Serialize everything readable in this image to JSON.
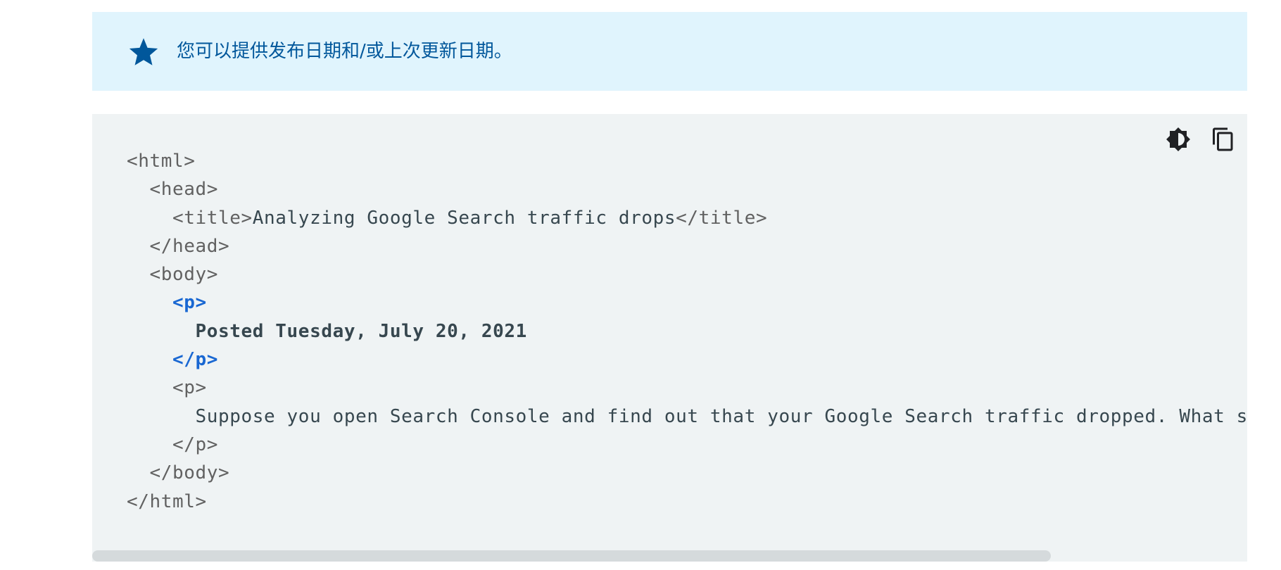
{
  "note": {
    "icon": "star-icon",
    "text": "您可以提供发布日期和/或上次更新日期。",
    "text_color": "#01579b",
    "background": "#e0f4fd"
  },
  "toolbar": {
    "theme_icon": "brightness-contrast-icon",
    "copy_icon": "copy-icon"
  },
  "code": {
    "background": "#eff3f4",
    "lines": [
      {
        "indent": "",
        "parts": [
          {
            "t": "<html>",
            "c": "tag"
          }
        ]
      },
      {
        "indent": "  ",
        "parts": [
          {
            "t": "<head>",
            "c": "tag"
          }
        ]
      },
      {
        "indent": "    ",
        "parts": [
          {
            "t": "<title>",
            "c": "tag"
          },
          {
            "t": "Analyzing Google Search traffic drops",
            "c": "txt"
          },
          {
            "t": "</title>",
            "c": "tag"
          }
        ]
      },
      {
        "indent": "  ",
        "parts": [
          {
            "t": "</head>",
            "c": "tag"
          }
        ]
      },
      {
        "indent": "  ",
        "parts": [
          {
            "t": "<body>",
            "c": "tag"
          }
        ]
      },
      {
        "indent": "    ",
        "parts": [
          {
            "t": "<p>",
            "c": "hl-tag"
          }
        ]
      },
      {
        "indent": "      ",
        "parts": [
          {
            "t": "Posted Tuesday, July 20, 2021",
            "c": "hl-text"
          }
        ]
      },
      {
        "indent": "    ",
        "parts": [
          {
            "t": "</p>",
            "c": "hl-tag"
          }
        ]
      },
      {
        "indent": "    ",
        "parts": [
          {
            "t": "<p>",
            "c": "tag"
          }
        ]
      },
      {
        "indent": "      ",
        "parts": [
          {
            "t": "Suppose you open Search Console and find out that your Google Search traffic dropped. What should you do?",
            "c": "txt"
          }
        ]
      },
      {
        "indent": "    ",
        "parts": [
          {
            "t": "</p>",
            "c": "tag"
          }
        ]
      },
      {
        "indent": "  ",
        "parts": [
          {
            "t": "</body>",
            "c": "tag"
          }
        ]
      },
      {
        "indent": "",
        "parts": [
          {
            "t": "</html>",
            "c": "tag"
          }
        ]
      }
    ]
  },
  "scrollbar": {
    "visible_fraction": 0.83,
    "scroll_position": 0
  }
}
